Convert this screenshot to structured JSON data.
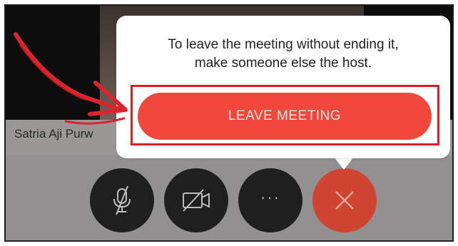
{
  "participant": {
    "name": "Satria Aji Purw"
  },
  "popover": {
    "message_line1": "To leave the meeting without ending it,",
    "message_line2": "make someone else the host.",
    "leave_button_label": "LEAVE MEETING"
  },
  "controls": {
    "more_label": "···"
  },
  "icons": {
    "mute": "microphone-muted-icon",
    "video": "video-off-icon",
    "more": "more-dots-icon",
    "end": "close-x-icon",
    "annotation": "red-arrow-annotation"
  },
  "colors": {
    "accent": "#f0493c",
    "highlight_border": "#e01b22",
    "end_button": "#cf4532",
    "control_button": "#1f1f1f",
    "annotation_arrow": "#d9252b"
  }
}
